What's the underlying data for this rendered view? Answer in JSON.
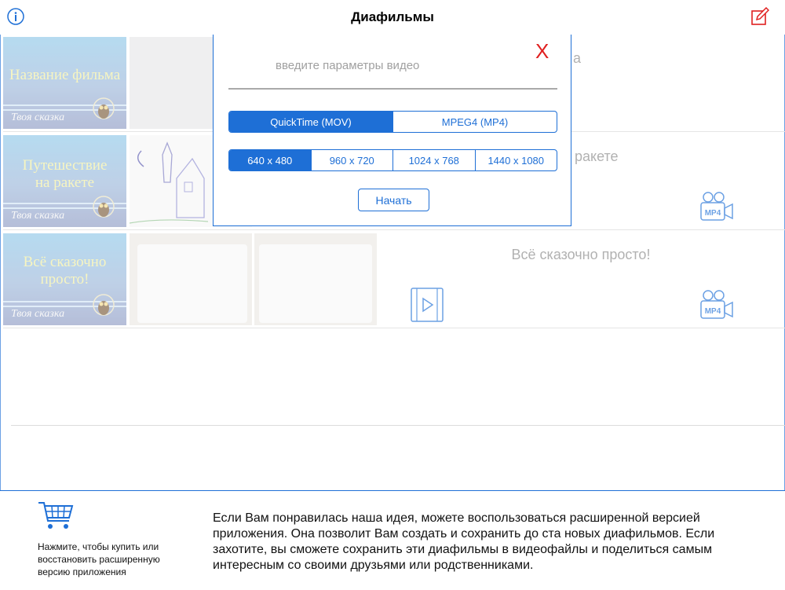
{
  "nav": {
    "title": "Диафильмы",
    "info_icon": "info-icon",
    "edit_icon": "compose-icon",
    "edit_color": "#e02020",
    "accent": "#1e6fd6"
  },
  "films": [
    {
      "cover_title": "Название фильма",
      "brand": "Твоя сказка",
      "title_partial": "а"
    },
    {
      "cover_title_lines": [
        "Путешествие",
        "на ракете"
      ],
      "brand": "Твоя сказка",
      "title_partial": "ракете"
    },
    {
      "cover_title_lines": [
        "Всё сказочно",
        "просто!"
      ],
      "brand": "Твоя сказка",
      "title": "Всё сказочно просто!"
    }
  ],
  "mp4_label": "MP4",
  "popover": {
    "placeholder": "введите параметры видео",
    "close_label": "X",
    "formats": [
      "QuickTime (MOV)",
      "MPEG4 (MP4)"
    ],
    "selected_format": "QuickTime (MOV)",
    "resolutions": [
      "640 x 480",
      "960 x 720",
      "1024 x 768",
      "1440 x 1080"
    ],
    "selected_resolution": "640 x 480",
    "start_label": "Начать"
  },
  "footer": {
    "cart_text": "Нажмите, чтобы купить или восстановить расширенную версию приложения",
    "promo_text": "Если Вам понравилась наша идея, можете воспользоваться расширенной версией приложения. Она позволит Вам создать и сохранить до ста новых диафильмов. Если захотите, вы сможете сохранить эти диафильмы в видеофайлы и поделиться самым интересным со своими друзьями или родственниками."
  }
}
